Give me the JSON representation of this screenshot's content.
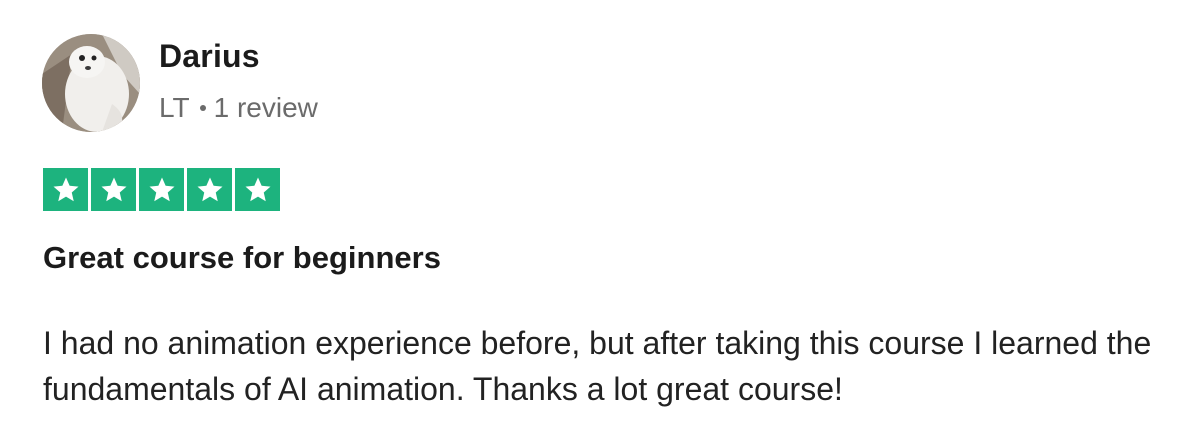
{
  "reviewer": {
    "name": "Darius",
    "country": "LT",
    "review_count": "1 review"
  },
  "rating": {
    "stars": 5,
    "max": 5,
    "color": "#1db37e"
  },
  "review": {
    "title": "Great course for beginners",
    "body": "I had no animation experience before, but after taking this course I learned the fundamentals of AI animation. Thanks a lot great course!"
  }
}
